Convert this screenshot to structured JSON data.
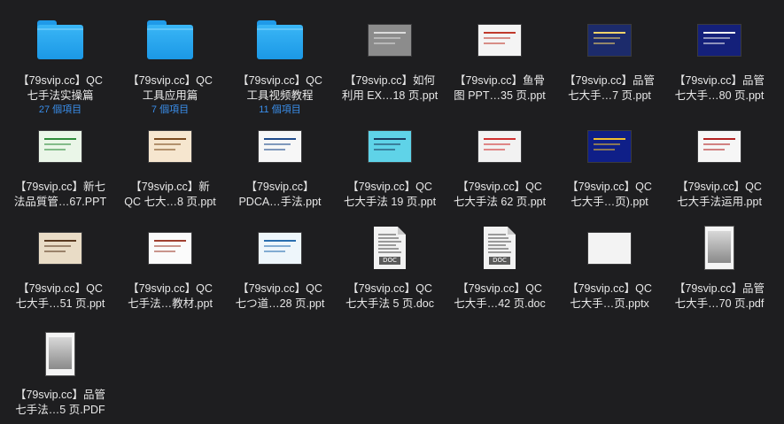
{
  "items": [
    {
      "line1": "【79svip.cc】QC",
      "line2": "七手法实操篇",
      "sub": "27 個項目",
      "kind": "folder"
    },
    {
      "line1": "【79svip.cc】QC",
      "line2": "工具应用篇",
      "sub": "7 個項目",
      "kind": "folder"
    },
    {
      "line1": "【79svip.cc】QC",
      "line2": "工具视频教程",
      "sub": "11 個項目",
      "kind": "folder"
    },
    {
      "line1": "【79svip.cc】如何",
      "line2": "利用 EX…18 页.ppt",
      "kind": "slide",
      "bg": "#8c8c8c",
      "accent": "#dcdcdc"
    },
    {
      "line1": "【79svip.cc】鱼骨",
      "line2": "图 PPT…35 页.ppt",
      "kind": "slide",
      "bg": "#f4f4f4",
      "accent": "#c0392b"
    },
    {
      "line1": "【79svip.cc】品管",
      "line2": "七大手…7 页.ppt",
      "kind": "slide",
      "bg": "#1c2b6b",
      "accent": "#f5d36a"
    },
    {
      "line1": "【79svip.cc】品管",
      "line2": "七大手…80 页.ppt",
      "kind": "slide",
      "bg": "#14207a",
      "accent": "#f2f2f2"
    },
    {
      "line1": "【79svip.cc】新七",
      "line2": "法品質管…67.PPT",
      "kind": "slide",
      "bg": "#eaf6e8",
      "accent": "#2e8b3a"
    },
    {
      "line1": "【79svip.cc】新",
      "line2": "QC 七大…8 页.ppt",
      "kind": "slide",
      "bg": "#f6e6cf",
      "accent": "#7a4a1e"
    },
    {
      "line1": "【79svip.cc】",
      "line2": "PDCA…手法.ppt",
      "kind": "slide",
      "bg": "#f7f7f7",
      "accent": "#1f4a8a"
    },
    {
      "line1": "【79svip.cc】QC",
      "line2": "七大手法 19 页.ppt",
      "kind": "slide",
      "bg": "#5fd3e8",
      "accent": "#1b3b5c"
    },
    {
      "line1": "【79svip.cc】QC",
      "line2": "七大手法 62 页.ppt",
      "kind": "slide",
      "bg": "#f2f2f2",
      "accent": "#d03030"
    },
    {
      "line1": "【79svip.cc】QC",
      "line2": "七大手…页).ppt",
      "kind": "slide",
      "bg": "#0f1f88",
      "accent": "#f0c030"
    },
    {
      "line1": "【79svip.cc】QC",
      "line2": "七大手法运用.ppt",
      "kind": "slide",
      "bg": "#f6f6f6",
      "accent": "#b32020"
    },
    {
      "line1": "【79svip.cc】QC",
      "line2": "七大手…51 页.ppt",
      "kind": "slide",
      "bg": "#e9dcc6",
      "accent": "#5a3a20"
    },
    {
      "line1": "【79svip.cc】QC",
      "line2": "七手法…教材.ppt",
      "kind": "slide",
      "bg": "#fbfbfb",
      "accent": "#a04030"
    },
    {
      "line1": "【79svip.cc】QC",
      "line2": "七つ道…28 页.ppt",
      "kind": "slide",
      "bg": "#eef6fb",
      "accent": "#2a6fb0"
    },
    {
      "line1": "【79svip.cc】QC",
      "line2": "七大手法 5 页.doc",
      "kind": "doc",
      "tag": "DOC"
    },
    {
      "line1": "【79svip.cc】QC",
      "line2": "七大手…42 页.doc",
      "kind": "doc",
      "tag": "DOC"
    },
    {
      "line1": "【79svip.cc】QC",
      "line2": "七大手…页.pptx",
      "kind": "slide",
      "bg": "#f3f3f3",
      "accent": "#f3f3f3"
    },
    {
      "line1": "【79svip.cc】品管",
      "line2": "七大手…70 页.pdf",
      "kind": "pdf"
    },
    {
      "line1": "【79svip.cc】品管",
      "line2": "七手法…5 页.PDF",
      "kind": "pdf"
    }
  ]
}
